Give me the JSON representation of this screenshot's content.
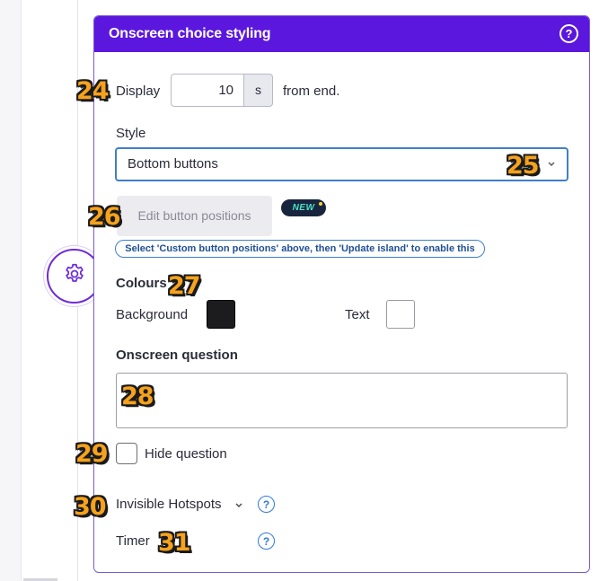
{
  "panel": {
    "title": "Onscreen choice styling",
    "help_glyph": "?"
  },
  "display": {
    "label": "Display",
    "value": "10",
    "unit": "s",
    "suffix": "from end."
  },
  "style": {
    "label": "Style",
    "selected": "Bottom buttons"
  },
  "edit_positions": {
    "button_label": "Edit button positions",
    "badge": "NEW",
    "hint": "Select 'Custom button positions' above, then 'Update island' to enable this"
  },
  "colours": {
    "heading": "Colours",
    "background_label": "Background",
    "background_color": "#1c1c1e",
    "text_label": "Text",
    "text_color": "#ffffff"
  },
  "question": {
    "heading": "Onscreen question",
    "value": ""
  },
  "hide_question": {
    "label": "Hide question",
    "checked": false
  },
  "invisible_hotspots": {
    "label": "Invisible Hotspots",
    "chevron": "⌄",
    "help_glyph": "?"
  },
  "timer": {
    "label": "Timer",
    "help_glyph": "?"
  },
  "step_markers": [
    "24",
    "25",
    "26",
    "27",
    "28",
    "29",
    "30",
    "31"
  ],
  "colors": {
    "header_bg": "#5b17dd",
    "accent": "#6f2bd9",
    "focus_blue": "#3f7fc9",
    "marker_orange": "#f6a21d"
  }
}
